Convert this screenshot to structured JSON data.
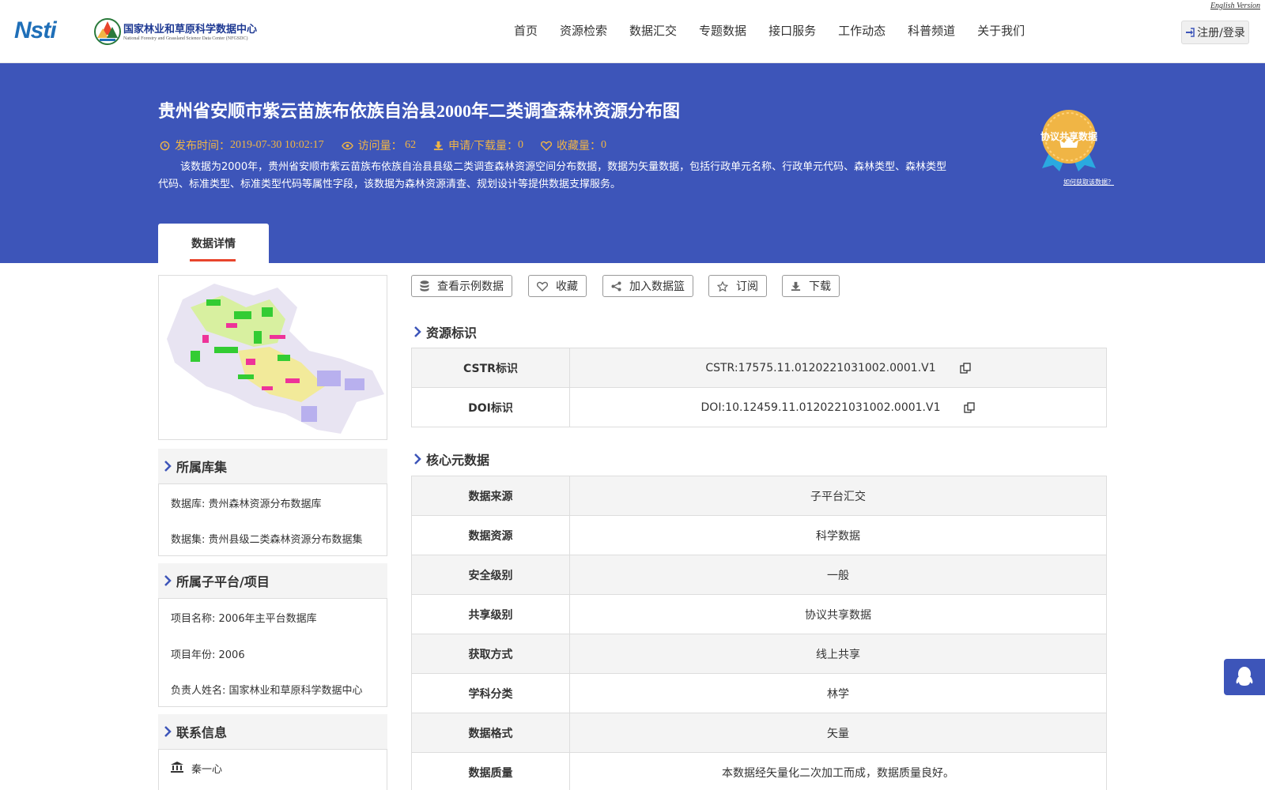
{
  "header": {
    "english_version": "English Version",
    "logo_text": "Nsti",
    "org_name_cn": "国家林业和草原科学数据中心",
    "org_name_en": "National Forestry and Grassland Science Data Center (NFGSDC)",
    "nav": [
      "首页",
      "资源检索",
      "数据汇交",
      "专题数据",
      "接口服务",
      "工作动态",
      "科普频道",
      "关于我们"
    ],
    "login_label": "注册/登录"
  },
  "banner": {
    "title": "贵州省安顺市紫云苗族布依族自治县2000年二类调查森林资源分布图",
    "publish_label": "发布时间：",
    "publish_time": "2019-07-30 10:02:17",
    "visits_label": "访问量：",
    "visits": "62",
    "downloads_label": "申请/下载量：",
    "downloads": "0",
    "favorites_label": "收藏量：",
    "favorites": "0",
    "description": "该数据为2000年，贵州省安顺市紫云苗族布依族自治县县级二类调查森林资源空间分布数据，数据为矢量数据，包括行政单元名称、行政单元代码、森林类型、森林类型代码、标准类型、标准类型代码等属性字段，该数据为森林资源清查、规划设计等提供数据支撑服务。",
    "badge_label": "协议共享数据",
    "howto_link": "如何获取该数据？",
    "tab_label": "数据详情"
  },
  "sidebar": {
    "collection_title": "所属库集",
    "database": "数据库: 贵州森林资源分布数据库",
    "dataset": "数据集: 贵州县级二类森林资源分布数据集",
    "project_title": "所属子平台/项目",
    "project_name": "项目名称: 2006年主平台数据库",
    "project_year": "项目年份: 2006",
    "owner": "负责人姓名: 国家林业和草原科学数据中心",
    "contact_title": "联系信息",
    "contact_name": "秦一心"
  },
  "actions": {
    "sample": "查看示例数据",
    "favorite": "收藏",
    "basket": "加入数据篮",
    "subscribe": "订阅",
    "download": "下载"
  },
  "resource_id": {
    "title": "资源标识",
    "cstr_key": "CSTR标识",
    "cstr_value": "CSTR:17575.11.0120221031002.0001.V1",
    "doi_key": "DOI标识",
    "doi_value": "DOI:10.12459.11.0120221031002.0001.V1"
  },
  "core_meta": {
    "title": "核心元数据",
    "rows": [
      {
        "k": "数据来源",
        "v": "子平台汇交"
      },
      {
        "k": "数据资源",
        "v": "科学数据"
      },
      {
        "k": "安全级别",
        "v": "一般"
      },
      {
        "k": "共享级别",
        "v": "协议共享数据"
      },
      {
        "k": "获取方式",
        "v": "线上共享"
      },
      {
        "k": "学科分类",
        "v": "林学"
      },
      {
        "k": "数据格式",
        "v": "矢量"
      },
      {
        "k": "数据质量",
        "v": "本数据经矢量化二次加工而成，数据质量良好。"
      }
    ]
  },
  "colors": {
    "banner": "#3d55b9",
    "meta_text": "#f0b545",
    "tab_underline": "#e8452c"
  }
}
